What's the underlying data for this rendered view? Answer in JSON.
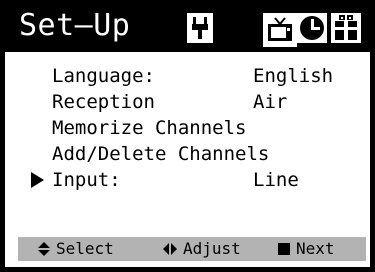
{
  "header": {
    "title": "Set–Up",
    "tabs": [
      {
        "icon": "settings-plug-icon",
        "active": true
      },
      {
        "icon": "tv-icon",
        "active": false
      },
      {
        "icon": "clock-icon",
        "active": false
      },
      {
        "icon": "gift-icon",
        "active": false
      }
    ]
  },
  "menu": {
    "items": [
      {
        "label": "Language:",
        "value": "English"
      },
      {
        "label": "Reception",
        "value": "Air"
      },
      {
        "label": "Memorize Channels",
        "value": ""
      },
      {
        "label": "Add/Delete Channels",
        "value": ""
      },
      {
        "label": "Input:",
        "value": "Line",
        "selected": true
      }
    ]
  },
  "footer": {
    "select_label": "Select",
    "adjust_label": "Adjust",
    "next_label": "Next"
  },
  "colors": {
    "background": "#ffffff",
    "title_bar": "#000000",
    "footer_bar": "#b3b3b3"
  }
}
